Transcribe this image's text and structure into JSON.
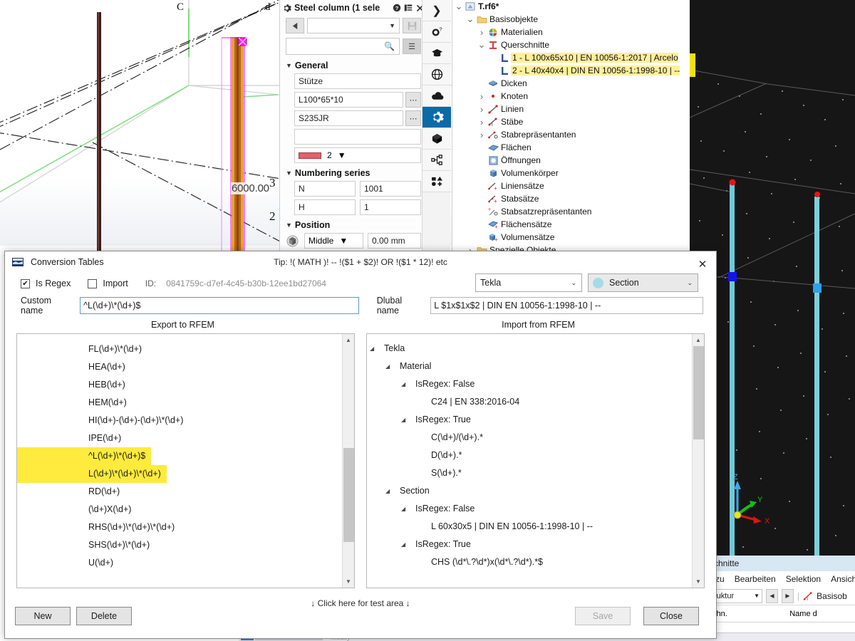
{
  "background": {
    "viewport": {
      "dimension_label": "6000.00",
      "grid_numbers": [
        "3",
        "2"
      ],
      "axis_labels": [
        "Z",
        "Y",
        "X"
      ]
    },
    "properties_panel": {
      "title": "Steel column (1 sele",
      "icons": {
        "gear": "gear-icon",
        "help": "help-icon",
        "layout": "layout-icon",
        "close": "close-icon",
        "back": "back-arrow-icon",
        "save": "save-icon",
        "search": "search-icon",
        "menu": "hamburger-icon"
      },
      "combo_value": "",
      "search_value": "",
      "groups": [
        {
          "label": "General"
        },
        {
          "label": "Numbering series"
        },
        {
          "label": "Position"
        }
      ],
      "general": {
        "name": "Stütze",
        "section": "L100*65*10",
        "material": "S235JR",
        "comment": "",
        "color_value": "2",
        "color_hex": "#e3616b"
      },
      "numbering": {
        "row1_label": "N",
        "row1_value": "1001",
        "row2_label": "H",
        "row2_value": "1"
      },
      "position": {
        "alignment": "Middle",
        "offset": "0.00 mm"
      }
    },
    "icon_strip": [
      {
        "name": "chevron-right-icon",
        "glyph": "❯",
        "active": false
      },
      {
        "name": "settings-help-icon",
        "glyph": "⚙",
        "active": false
      },
      {
        "name": "graduation-cap-icon",
        "glyph": "🎓",
        "active": false
      },
      {
        "name": "globe-icon",
        "glyph": "⊕",
        "active": false
      },
      {
        "name": "cloud-icon",
        "glyph": "☁",
        "active": false
      },
      {
        "name": "gear-icon",
        "glyph": "⚙",
        "active": true
      },
      {
        "name": "cube-icon",
        "glyph": "⬢",
        "active": false
      },
      {
        "name": "hierarchy-icon",
        "glyph": "⚭",
        "active": false
      },
      {
        "name": "shapes-icon",
        "glyph": "■",
        "active": false
      }
    ],
    "model_tree": [
      {
        "label": "T.rf6*",
        "depth": 0,
        "exp": "v",
        "icon": "file-icon",
        "bold": true,
        "hl": false
      },
      {
        "label": "Basisobjekte",
        "depth": 1,
        "exp": "v",
        "icon": "folder-icon",
        "bold": false,
        "hl": false
      },
      {
        "label": "Materialien",
        "depth": 2,
        "exp": ">",
        "icon": "materials-icon",
        "bold": false,
        "hl": false
      },
      {
        "label": "Querschnitte",
        "depth": 2,
        "exp": "v",
        "icon": "section-icon",
        "bold": false,
        "hl": false
      },
      {
        "label": "1 - L 100x65x10 | EN 10056-1:2017 | Arcelo",
        "depth": 3,
        "exp": "",
        "icon": "angle-icon",
        "bold": false,
        "hl": true
      },
      {
        "label": "2 - L 40x40x4 | DIN EN 10056-1:1998-10 | --",
        "depth": 3,
        "exp": "",
        "icon": "angle-icon",
        "bold": false,
        "hl": true
      },
      {
        "label": "Dicken",
        "depth": 2,
        "exp": "",
        "icon": "thickness-icon",
        "bold": false,
        "hl": false
      },
      {
        "label": "Knoten",
        "depth": 2,
        "exp": ">",
        "icon": "node-icon",
        "bold": false,
        "hl": false
      },
      {
        "label": "Linien",
        "depth": 2,
        "exp": ">",
        "icon": "line-icon",
        "bold": false,
        "hl": false
      },
      {
        "label": "Stäbe",
        "depth": 2,
        "exp": ">",
        "icon": "member-icon",
        "bold": false,
        "hl": false
      },
      {
        "label": "Stabrepräsentanten",
        "depth": 2,
        "exp": ">",
        "icon": "member-rep-icon",
        "bold": false,
        "hl": false
      },
      {
        "label": "Flächen",
        "depth": 2,
        "exp": "",
        "icon": "surface-icon",
        "bold": false,
        "hl": false
      },
      {
        "label": "Öffnungen",
        "depth": 2,
        "exp": "",
        "icon": "opening-icon",
        "bold": false,
        "hl": false
      },
      {
        "label": "Volumenkörper",
        "depth": 2,
        "exp": "",
        "icon": "solid-icon",
        "bold": false,
        "hl": false
      },
      {
        "label": "Liniensätze",
        "depth": 2,
        "exp": "",
        "icon": "line-set-icon",
        "bold": false,
        "hl": false
      },
      {
        "label": "Stabsätze",
        "depth": 2,
        "exp": "",
        "icon": "member-set-icon",
        "bold": false,
        "hl": false
      },
      {
        "label": "Stabsatzrepräsentanten",
        "depth": 2,
        "exp": "",
        "icon": "member-set-rep-icon",
        "bold": false,
        "hl": false
      },
      {
        "label": "Flächensätze",
        "depth": 2,
        "exp": "",
        "icon": "surface-set-icon",
        "bold": false,
        "hl": false
      },
      {
        "label": "Volumensätze",
        "depth": 2,
        "exp": "",
        "icon": "solid-set-icon",
        "bold": false,
        "hl": false
      },
      {
        "label": "Spezielle Objekte",
        "depth": 1,
        "exp": ">",
        "icon": "folder-icon",
        "bold": false,
        "hl": false
      }
    ],
    "behind_window": {
      "title": "chnitte",
      "menu": [
        "zu",
        "Bearbeiten",
        "Selektion",
        "Ansich"
      ],
      "combo": "ruktur",
      "tool_label": "Basisob",
      "col1": "chn.",
      "col2": "Name d"
    }
  },
  "dialog": {
    "title": "Conversion Tables",
    "tip": "Tip: !( MATH )! -- !($1 + $2)! OR !($1 * 12)! etc",
    "close_glyph": "✕",
    "is_regex": {
      "label": "Is Regex",
      "checked": true,
      "check_glyph": "✔"
    },
    "import": {
      "label": "Import",
      "checked": false,
      "check_glyph": ""
    },
    "id_label": "ID:",
    "id_value": "0841759c-d7ef-4c45-b30b-12ee1bd27064",
    "custom_name": {
      "label": "Custom name",
      "value": "^L(\\d+)\\*(\\d+)$"
    },
    "dlubal_name": {
      "label": "Dlubal name",
      "value": "L $1x$1x$2 | DIN EN 10056-1:1998-10 | --"
    },
    "app_dropdown": {
      "value": "Tekla",
      "caret": "⌄"
    },
    "type_dropdown": {
      "value": "Section",
      "caret": "⌄",
      "dot_color": "#a5dbe8"
    },
    "left_header": "Export to RFEM",
    "right_header": "Import from RFEM",
    "export_list": [
      {
        "text": "FL(\\d+)\\*(\\d+)",
        "hl": false
      },
      {
        "text": "HEA(\\d+)",
        "hl": false
      },
      {
        "text": "HEB(\\d+)",
        "hl": false
      },
      {
        "text": "HEM(\\d+)",
        "hl": false
      },
      {
        "text": "HI(\\d+)-(\\d+)-(\\d+)\\*(\\d+)",
        "hl": false
      },
      {
        "text": "IPE(\\d+)",
        "hl": false
      },
      {
        "text": "^L(\\d+)\\*(\\d+)$",
        "hl": true
      },
      {
        "text": "L(\\d+)\\*(\\d+)\\*(\\d+)",
        "hl": true
      },
      {
        "text": "RD(\\d+)",
        "hl": false
      },
      {
        "text": "(\\d+)X(\\d+)",
        "hl": false
      },
      {
        "text": "RHS(\\d+)\\*(\\d+)\\*(\\d+)",
        "hl": false
      },
      {
        "text": "SHS(\\d+)\\*(\\d+)",
        "hl": false
      },
      {
        "text": "U(\\d+)",
        "hl": false
      }
    ],
    "import_tree": [
      {
        "text": "Tekla",
        "depth": 0,
        "arrow": "◢"
      },
      {
        "text": "Material",
        "depth": 1,
        "arrow": "◢"
      },
      {
        "text": "IsRegex:     False",
        "depth": 2,
        "arrow": "◢"
      },
      {
        "text": "C24 | EN 338:2016-04",
        "depth": 3,
        "arrow": ""
      },
      {
        "text": "IsRegex:     True",
        "depth": 2,
        "arrow": "◢"
      },
      {
        "text": "C(\\d+)/(\\d+).*",
        "depth": 3,
        "arrow": ""
      },
      {
        "text": "D(\\d+).*",
        "depth": 3,
        "arrow": ""
      },
      {
        "text": "S(\\d+).*",
        "depth": 3,
        "arrow": ""
      },
      {
        "text": "Section",
        "depth": 1,
        "arrow": "◢"
      },
      {
        "text": "IsRegex:     False",
        "depth": 2,
        "arrow": "◢"
      },
      {
        "text": "L 60x30x5 | DIN EN 10056-1:1998-10 | --",
        "depth": 3,
        "arrow": ""
      },
      {
        "text": "IsRegex:     True",
        "depth": 2,
        "arrow": "◢"
      },
      {
        "text": "CHS (\\d*\\.?\\d*)x(\\d*\\.?\\d*).*$",
        "depth": 3,
        "arrow": ""
      }
    ],
    "test_area_hint": "↓ Click here for test area ↓",
    "buttons": {
      "new": "New",
      "delete": "Delete",
      "save": "Save",
      "close": "Close",
      "save_disabled": true
    }
  }
}
